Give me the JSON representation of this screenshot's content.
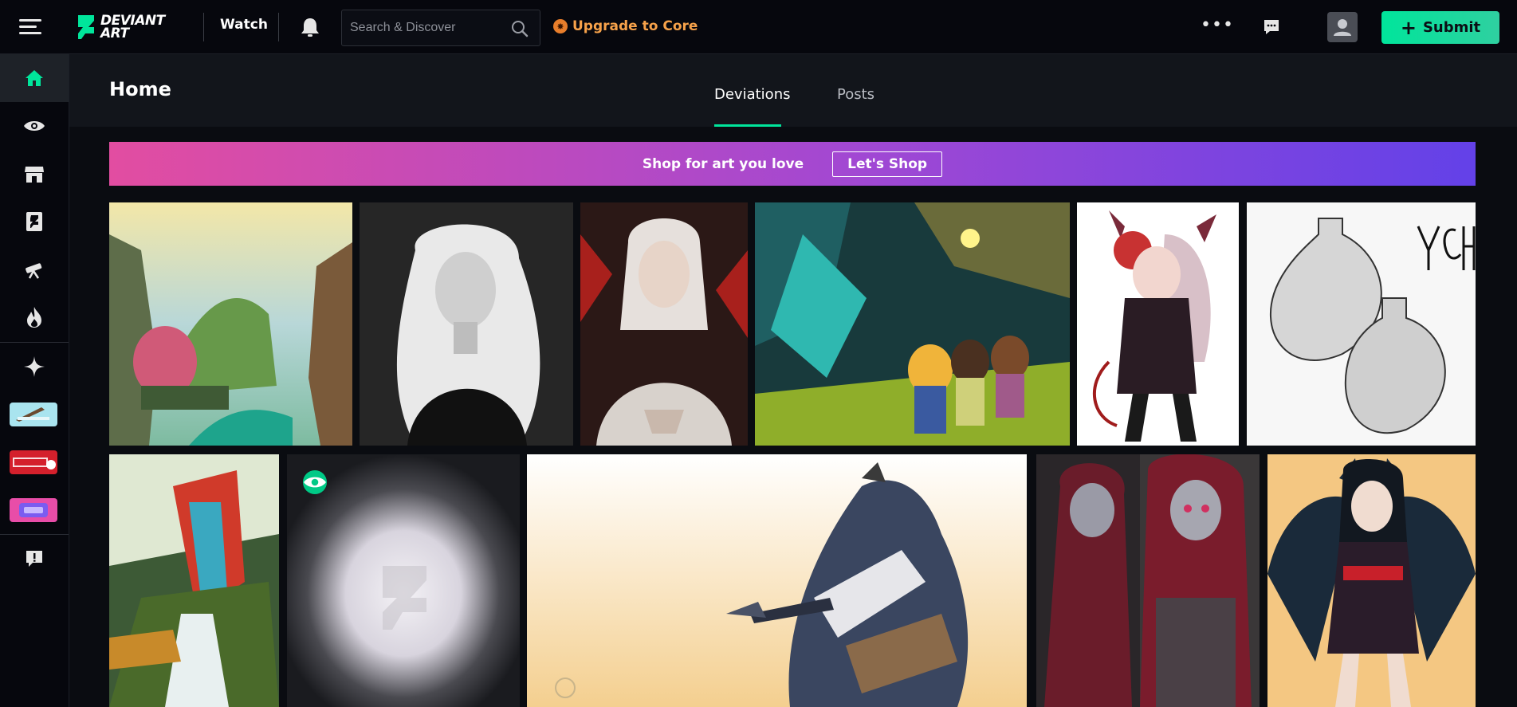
{
  "topbar": {
    "logo_line1": "DEVIANT",
    "logo_line2": "ART",
    "watch_label": "Watch",
    "search_placeholder": "Search & Discover",
    "upgrade_label": "Upgrade to Core",
    "submit_label": "Submit"
  },
  "sidebar": {
    "items": [
      {
        "name": "home",
        "icon": "home-icon"
      },
      {
        "name": "watch",
        "icon": "eye-icon"
      },
      {
        "name": "shop",
        "icon": "shop-icon"
      },
      {
        "name": "deviantart",
        "icon": "deviantart-logo-icon"
      },
      {
        "name": "explore",
        "icon": "telescope-icon"
      },
      {
        "name": "popular",
        "icon": "flame-icon"
      },
      {
        "name": "dreamup",
        "icon": "sparkle-icon"
      },
      {
        "name": "feedback",
        "icon": "feedback-icon"
      }
    ]
  },
  "header": {
    "title": "Home",
    "tabs": [
      {
        "label": "Deviations",
        "active": true
      },
      {
        "label": "Posts",
        "active": false
      }
    ]
  },
  "banner": {
    "text": "Shop for art you love",
    "button_label": "Let's Shop"
  },
  "colors": {
    "accent": "#00e59b",
    "upgrade": "#f7a24a",
    "banner_start": "#e24da1",
    "banner_end": "#6341e8"
  }
}
